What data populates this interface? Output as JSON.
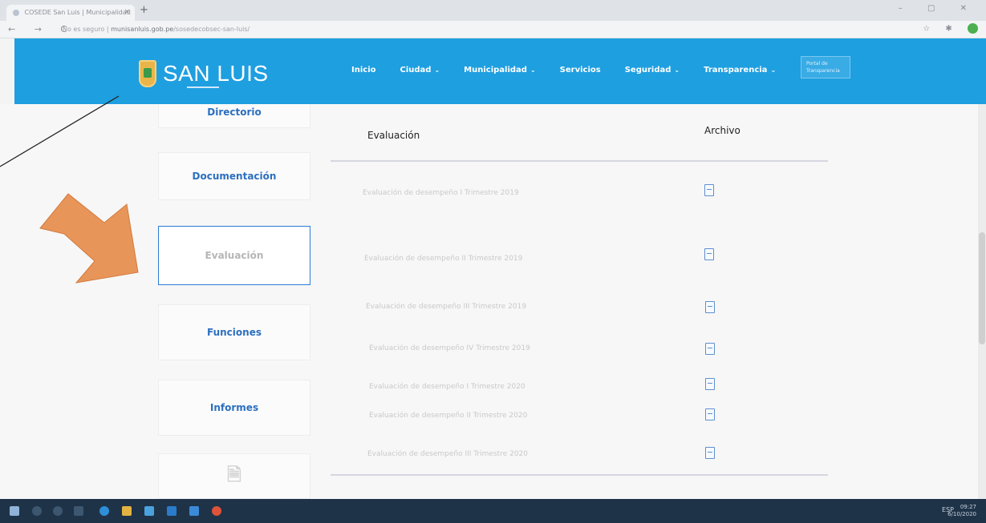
{
  "browser": {
    "tab_title": "COSEDE San Luis | Municipalidad",
    "tab_close": "×",
    "new_tab": "+",
    "nav_buttons": "← → C",
    "security_label": "No es seguro",
    "url_domain": "munisanluis.gob.pe",
    "url_path": "/sosedecobsec-san-luis/",
    "extensions": "☆ ✱",
    "window_controls": "– ▢ ✕"
  },
  "site": {
    "logo_text": "SAN LUIS",
    "nav": [
      {
        "label": "Inicio",
        "has_dropdown": false
      },
      {
        "label": "Ciudad",
        "has_dropdown": true
      },
      {
        "label": "Municipalidad",
        "has_dropdown": true
      },
      {
        "label": "Servicios",
        "has_dropdown": false
      },
      {
        "label": "Seguridad",
        "has_dropdown": true
      },
      {
        "label": "Transparencia",
        "has_dropdown": true
      }
    ],
    "nav_chevron": "⌄",
    "transparency_badge": "Portal de Transparencia"
  },
  "sidebar": {
    "items": [
      {
        "label": "Directorio",
        "active": false
      },
      {
        "label": "Documentación",
        "active": false
      },
      {
        "label": "Evaluación",
        "active": true
      },
      {
        "label": "Funciones",
        "active": false
      },
      {
        "label": "Informes",
        "active": false
      }
    ],
    "doc_icon_glyph": "🗎"
  },
  "table": {
    "headers": {
      "evaluation": "Evaluación",
      "file": "Archivo"
    },
    "rows": [
      {
        "label": "Evaluación de desempeño I Trimestre 2019"
      },
      {
        "label": "Evaluación de desempeño II Trimestre 2019"
      },
      {
        "label": "Evaluación de desempeño III Trimestre 2019"
      },
      {
        "label": "Evaluación de desempeño IV Trimestre 2019"
      },
      {
        "label": "Evaluación de desempeño I Trimestre 2020"
      },
      {
        "label": "Evaluación de desempeño II Trimestre 2020"
      },
      {
        "label": "Evaluación de desempeño III Trimestre 2020"
      }
    ]
  },
  "taskbar": {
    "tray_text": "ESP",
    "time": "09:27",
    "date": "6/10/2020"
  },
  "colors": {
    "header_blue": "#1e9fe0",
    "link_blue": "#2c6fbf",
    "arrow_orange": "#e8955a",
    "taskbar": "#1f3348"
  }
}
